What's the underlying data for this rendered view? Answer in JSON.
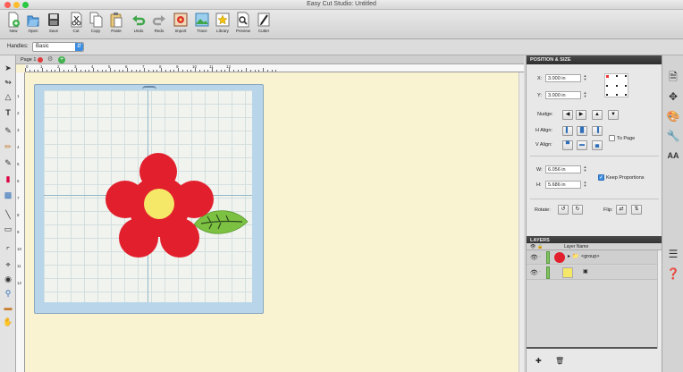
{
  "window": {
    "title": "Easy Cut Studio: Untitled"
  },
  "toolbar": {
    "buttons": [
      {
        "label": "New",
        "icon": "new-document-icon"
      },
      {
        "label": "Open",
        "icon": "open-folder-icon"
      },
      {
        "label": "Save",
        "icon": "save-disk-icon"
      },
      {
        "label": "Cut",
        "icon": "scissors-icon"
      },
      {
        "label": "Copy",
        "icon": "copy-icon"
      },
      {
        "label": "Paste",
        "icon": "paste-icon"
      },
      {
        "label": "Undo",
        "icon": "undo-icon"
      },
      {
        "label": "Redo",
        "icon": "redo-icon"
      },
      {
        "label": "Import",
        "icon": "import-icon"
      },
      {
        "label": "Trace",
        "icon": "trace-icon"
      },
      {
        "label": "Library",
        "icon": "library-icon"
      },
      {
        "label": "Preview",
        "icon": "preview-magnifier-icon"
      },
      {
        "label": "Cutter",
        "icon": "cutter-icon"
      }
    ]
  },
  "handles": {
    "label": "Handles:",
    "value": "Basic"
  },
  "canvas": {
    "tab_label": "Page 1",
    "ruler_h": [
      "0",
      "1",
      "2",
      "3",
      "4",
      "5",
      "6",
      "7",
      "8",
      "9",
      "10",
      "11",
      "12"
    ],
    "ruler_v": [
      "1",
      "2",
      "3",
      "4",
      "5",
      "6",
      "7",
      "8",
      "9",
      "10",
      "11",
      "12"
    ],
    "colors": {
      "petal": "#e21f2d",
      "center": "#f5e868",
      "leaf": "#7cc142",
      "mat": "#b8d5ea",
      "background": "#faf3d2"
    }
  },
  "position_size": {
    "header": "POSITION & SIZE",
    "x_label": "X:",
    "x_value": "3.000 in",
    "y_label": "Y:",
    "y_value": "3.000 in",
    "nudge_label": "Nudge:",
    "halign_label": "H Align:",
    "valign_label": "V Align:",
    "to_page_label": "To Page",
    "to_page_checked": false,
    "w_label": "W:",
    "w_value": "6.056 in",
    "h_label": "H:",
    "h_value": "5.686 in",
    "keep_proportions_label": "Keep Proportions",
    "keep_proportions_checked": true,
    "rotate_label": "Rotate:",
    "flip_label": "Flip:"
  },
  "layers": {
    "header": "LAYERS",
    "column_name": "Layer Name",
    "rows": [
      {
        "name": "<group>"
      },
      {
        "name": ""
      }
    ]
  }
}
